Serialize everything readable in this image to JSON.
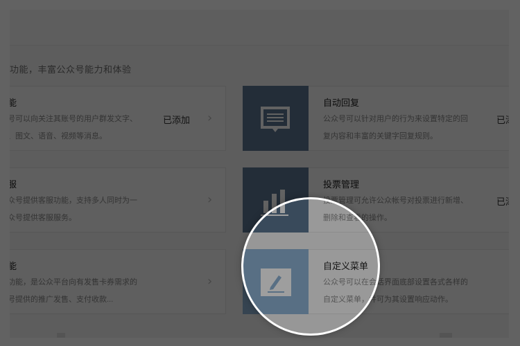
{
  "intro": "功能，丰富公众号能力和体验",
  "plugins": {
    "mass_send": {
      "title": "能",
      "desc1": "号可以向关注其账号的用户群发文字、",
      "desc2": "、图文、语音、视频等消息。",
      "status": "已添加",
      "chevron": "›"
    },
    "auto_reply": {
      "title": "自动回复",
      "desc1": "公众号可以针对用户的行为来设置特定的回",
      "desc2": "复内容和丰富的关键字回复规则。",
      "status": "已添",
      "icon": "chat-icon",
      "icon_color": "#5c7893"
    },
    "customer_service": {
      "title": "服",
      "desc1": "众号提供客服功能，支持多人同时为一",
      "desc2": "众号提供客服服务。",
      "chevron": "›"
    },
    "vote": {
      "title": "投票管理",
      "desc1": "投票管理可允许公众帐号对投票进行新增、",
      "desc2": "删除和查看的操作。",
      "status": "已添",
      "icon": "bar-chart-icon",
      "icon_color": "#5c7893"
    },
    "card_coupon": {
      "title": "能",
      "desc1": "功能，是公众平台向有发售卡券需求的",
      "desc2": "号提供的推广发售、支付收款...",
      "chevron": "›"
    },
    "custom_menu": {
      "title": "自定义菜单",
      "desc1": "公众号可以在会话界面底部设置各式各样的",
      "desc2": "自定义菜单，并可为其设置响应动作。",
      "icon": "edit-icon",
      "icon_color": "#8fb3d6"
    }
  }
}
